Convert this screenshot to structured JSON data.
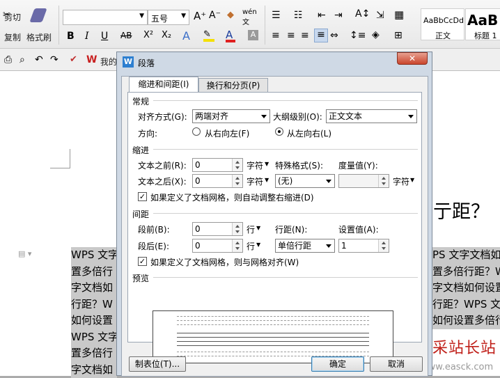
{
  "ribbon": {
    "cut": "剪切",
    "copy": "复制",
    "format_painter": "格式刷",
    "font_size": "五号",
    "bold": "B",
    "italic": "I",
    "underline": "U",
    "strike": "AB",
    "superscript": "X²",
    "subscript": "X₂",
    "styles": [
      {
        "sample": "AaBbCcDd",
        "name": "正文"
      },
      {
        "sample": "AaB",
        "name": "标题 1"
      }
    ]
  },
  "qat": {
    "wps_label": "我的"
  },
  "document": {
    "lines": [
      "WPS 文字",
      "置多倍行",
      "字文档如",
      "行距？W",
      "如何设置",
      "WPS 文字",
      "置多倍行",
      "字文档如"
    ],
    "right_lines": [
      "PS 文字文档如",
      "置多倍行距？W",
      "字文档如何设置",
      "行距？WPS 文",
      "如何设置多倍行"
    ],
    "heading_fragment": "亍距？"
  },
  "watermark": {
    "title": "易采站长站",
    "url": "www.easck.com"
  },
  "dialog": {
    "title": "段落",
    "close": "✕",
    "tabs": [
      "缩进和间距(I)",
      "换行和分页(P)"
    ],
    "general": {
      "section": "常规",
      "alignment_label": "对齐方式(G):",
      "alignment_value": "两端对齐",
      "outline_label": "大纲级别(O):",
      "outline_value": "正文文本",
      "direction_label": "方向:",
      "rtl": "从右向左(F)",
      "ltr": "从左向右(L)"
    },
    "indent": {
      "section": "缩进",
      "before_label": "文本之前(R):",
      "before_value": "0",
      "before_unit": "字符",
      "after_label": "文本之后(X):",
      "after_value": "0",
      "after_unit": "字符",
      "special_label": "特殊格式(S):",
      "special_value": "(无)",
      "by_label": "度量值(Y):",
      "by_unit": "字符",
      "auto_adjust": "如果定义了文档网格，则自动调整右缩进(D)"
    },
    "spacing": {
      "section": "间距",
      "before_label": "段前(B):",
      "before_value": "0",
      "before_unit": "行",
      "after_label": "段后(E):",
      "after_value": "0",
      "after_unit": "行",
      "line_label": "行距(N):",
      "line_value": "单倍行距",
      "at_label": "设置值(A):",
      "at_value": "1",
      "snap_grid": "如果定义了文档网格，则与网格对齐(W)"
    },
    "preview": {
      "section": "预览"
    },
    "buttons": {
      "tabs": "制表位(T)...",
      "ok": "确定",
      "cancel": "取消"
    }
  }
}
